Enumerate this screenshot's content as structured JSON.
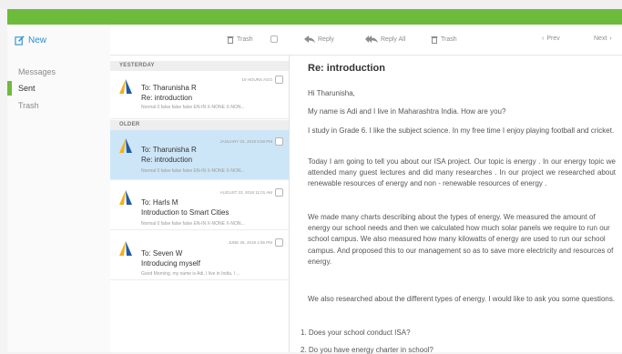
{
  "sidebar": {
    "new_label": "New",
    "items": [
      {
        "label": "Messages",
        "active": false
      },
      {
        "label": "Sent",
        "active": true
      },
      {
        "label": "Trash",
        "active": false
      }
    ]
  },
  "toolbar": {
    "list_trash_label": "Trash",
    "reply_label": "Reply",
    "reply_all_label": "Reply All",
    "trash_label": "Trash",
    "prev_label": "Prev",
    "next_label": "Next"
  },
  "message_list": {
    "group_yesterday": "YESTERDAY",
    "group_older": "OLDER",
    "messages": [
      {
        "to": "To: Tharunisha R",
        "subject": "Re: introduction",
        "preview": "Normal 0 false false false EN-IN X-NONE X-NON...",
        "date": "19 HOURS AGO"
      },
      {
        "to": "To: Tharunisha R",
        "subject": "Re: introduction",
        "preview": "Normal 0 false false false EN-IN X-NONE X-NON...",
        "date": "JANUARY 02, 2019 6:58 PM"
      },
      {
        "to": "To: Harls M",
        "subject": "Introduction to Smart Cities",
        "preview": "Normal 0 false false false EN-IN X-NONE X-NON...",
        "date": "AUGUST 23, 2018 11:01 AM"
      },
      {
        "to": "To: Seven W",
        "subject": "Introducing myself",
        "preview": "Good Morning, my name is Adi. I live in India. I ...",
        "date": "JUNE 26, 2018 1:56 PM"
      }
    ]
  },
  "reader": {
    "subject": "Re: introduction",
    "greeting": "Hi  Tharunisha,",
    "paragraphs": [
      "My name is Adi and I live in Maharashtra India. How are you?",
      "I study in Grade 6. I like the subject science. In my free time I enjoy playing football and cricket.",
      " Today I am going to tell you about our ISA  project. Our topic is energy . In our energy topic  we  attended many guest lectures and did many researches . In our project  we  researched  about  renewable resources of  energy and non - renewable resources  of energy  .",
      "We made many charts describing about the types of energy. We measured the amount of energy our school needs and then we calculated how much solar panels we require to run our school campus. We also measured how many kilowatts of energy are used to run our school campus. And proposed this to our management so as to save more electricity and resources of energy.",
      "We also researched about the different types of energy. I would like to ask you some questions."
    ],
    "questions": [
      "1.  Does your school conduct ISA?",
      "2.  Do you have energy charter in school?"
    ]
  },
  "colors": {
    "accent_green": "#6dbb3b",
    "link_blue": "#2c8fd1",
    "selected_row": "#cde6f7",
    "logo_yellow": "#f2b21c",
    "logo_blue": "#1f5aa8"
  }
}
